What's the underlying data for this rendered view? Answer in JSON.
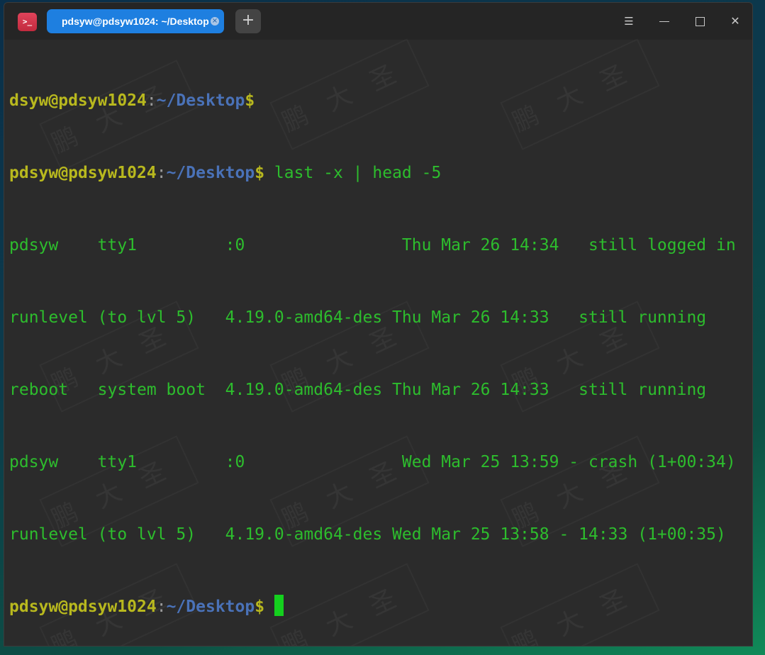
{
  "window": {
    "app_icon_label": ">_",
    "tab_title": "pdsyw@pdsyw1024: ~/Desktop",
    "tab_close_glyph": "×",
    "new_tab_glyph": "+",
    "menu_glyph": "☰",
    "close_glyph": "✕"
  },
  "terminal": {
    "line0": {
      "user": "dsyw@pdsyw1024",
      "colon": ":",
      "path": "~/Desktop",
      "dollar": "$"
    },
    "line1": {
      "user": "pdsyw@pdsyw1024",
      "colon": ":",
      "path": "~/Desktop",
      "dollar": "$",
      "command": " last -x | head -5"
    },
    "output": [
      "pdsyw    tty1         :0                Thu Mar 26 14:34   still logged in",
      "runlevel (to lvl 5)   4.19.0-amd64-des Thu Mar 26 14:33   still running",
      "reboot   system boot  4.19.0-amd64-des Thu Mar 26 14:33   still running",
      "pdsyw    tty1         :0                Wed Mar 25 13:59 - crash (1+00:34)",
      "runlevel (to lvl 5)   4.19.0-amd64-des Wed Mar 25 13:58 - 14:33 (1+00:35)"
    ],
    "line7": {
      "user": "pdsyw@pdsyw1024",
      "colon": ":",
      "path": "~/Desktop",
      "dollar": "$ "
    }
  },
  "watermark_text": "鹏大圣",
  "colors": {
    "prompt_user": "#b8b81e",
    "prompt_path": "#4a72b8",
    "output_text": "#2dbd2d",
    "cursor": "#14d01e",
    "tab_active": "#1e7fe0",
    "terminal_bg": "#2b2b2b"
  }
}
